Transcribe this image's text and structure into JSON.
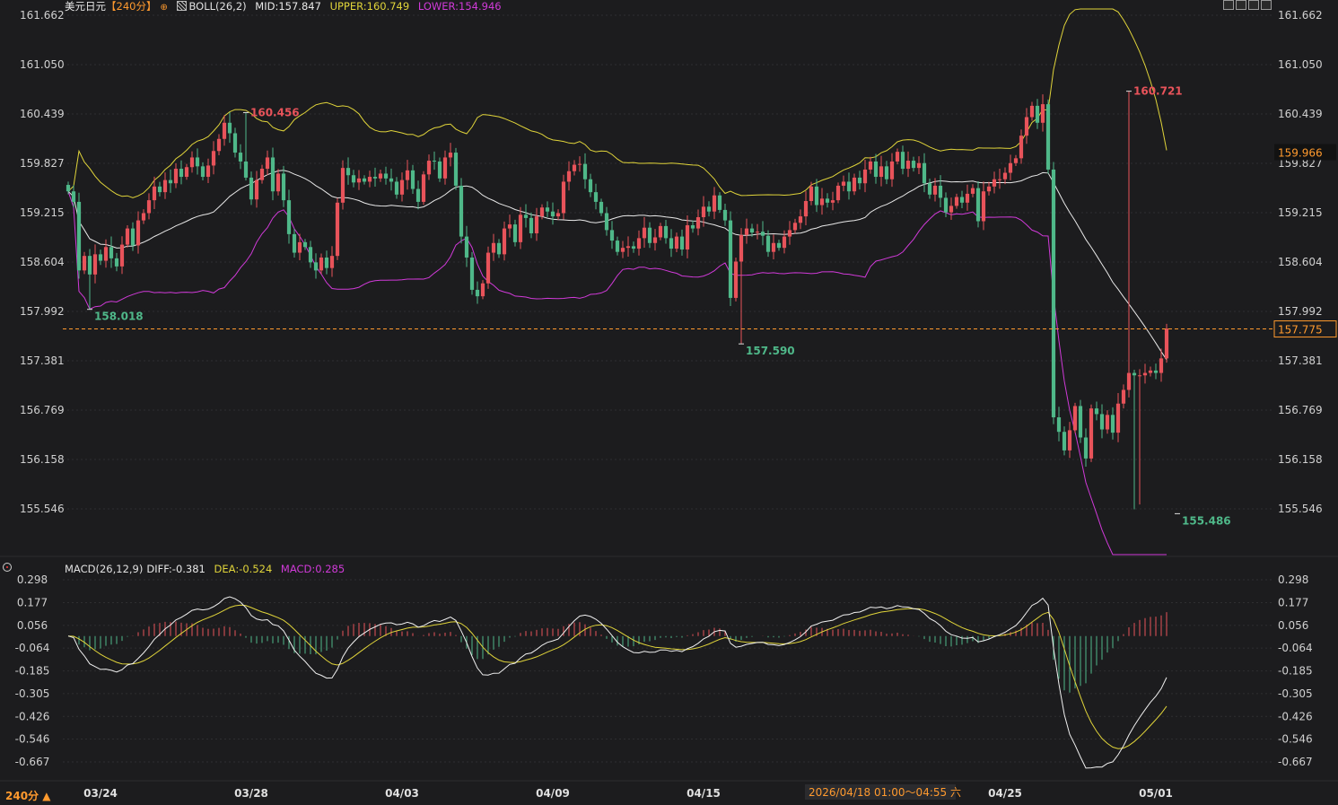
{
  "header": {
    "symbol": "美元日元",
    "period_tag": "【240分】",
    "boll_label": "BOLL(26,2)",
    "mid": "MID:157.847",
    "upper": "UPPER:160.749",
    "lower": "LOWER:154.946"
  },
  "macd_header": {
    "label": "MACD(26,12,9)",
    "diff": "DIFF:-0.381",
    "dea": "DEA:-0.524",
    "macd": "MACD:0.285"
  },
  "period_selector": "240分 ▲",
  "time_tooltip": "2026/04/18 01:00～04:55 六",
  "colors": {
    "up": "#e8535a",
    "down": "#4fb889",
    "boll_mid": "#e8e8e8",
    "boll_upper": "#e0d43a",
    "boll_lower": "#d03ad8",
    "dea": "#e0d43a",
    "diff": "#f0f0f0",
    "macd_label": "#d03ad8",
    "price_line": "#ff9a2e"
  },
  "chart_data": {
    "type": "candlestick",
    "price_axis": {
      "ticks": [
        161.662,
        161.05,
        160.439,
        159.827,
        159.215,
        158.604,
        157.992,
        157.381,
        156.769,
        156.158,
        155.546
      ],
      "range": [
        155.09,
        161.77
      ],
      "current_price": "157.775",
      "hover_price": "159.966"
    },
    "macd_axis": {
      "ticks": [
        0.298,
        0.177,
        0.056,
        -0.064,
        -0.185,
        -0.305,
        -0.426,
        -0.546,
        -0.667
      ],
      "range": [
        -0.8,
        0.34
      ]
    },
    "date_labels": [
      "03/24",
      "03/28",
      "04/03",
      "04/09",
      "04/15",
      "04/25",
      "05/01"
    ],
    "annotations": [
      {
        "text": "160.456",
        "kind": "high"
      },
      {
        "text": "158.018",
        "kind": "low"
      },
      {
        "text": "157.590",
        "kind": "low"
      },
      {
        "text": "160.721",
        "kind": "high"
      },
      {
        "text": "155.486",
        "kind": "low"
      }
    ],
    "candle_closes": [
      159.48,
      159.35,
      158.5,
      158.68,
      158.45,
      158.7,
      158.62,
      158.79,
      158.65,
      158.55,
      158.82,
      159.02,
      158.81,
      159.12,
      159.21,
      159.37,
      159.54,
      159.47,
      159.62,
      159.58,
      159.76,
      159.66,
      159.78,
      159.9,
      159.79,
      159.66,
      159.8,
      159.98,
      160.13,
      160.33,
      160.2,
      159.96,
      159.85,
      159.65,
      159.38,
      159.62,
      159.76,
      159.9,
      159.48,
      159.7,
      159.37,
      158.95,
      158.72,
      158.85,
      158.79,
      158.6,
      158.5,
      158.66,
      158.53,
      158.68,
      159.34,
      159.77,
      159.68,
      159.59,
      159.64,
      159.6,
      159.66,
      159.64,
      159.7,
      159.64,
      159.6,
      159.44,
      159.62,
      159.74,
      159.51,
      159.35,
      159.69,
      159.86,
      159.85,
      159.64,
      159.9,
      159.96,
      159.55,
      158.92,
      158.66,
      158.26,
      158.18,
      158.34,
      158.72,
      158.84,
      158.7,
      159.02,
      159.07,
      158.85,
      159.19,
      159.15,
      158.96,
      159.17,
      159.28,
      159.23,
      159.17,
      159.21,
      159.6,
      159.73,
      159.81,
      159.82,
      159.63,
      159.47,
      159.35,
      159.21,
      159.0,
      158.87,
      158.73,
      158.78,
      158.8,
      158.77,
      158.9,
      159.03,
      158.84,
      158.91,
      159.05,
      158.9,
      158.77,
      158.92,
      158.76,
      159.06,
      159.02,
      159.16,
      159.29,
      159.23,
      159.43,
      159.25,
      159.12,
      158.16,
      158.61,
      158.94,
      159.02,
      158.97,
      158.98,
      158.93,
      158.73,
      158.84,
      158.78,
      158.92,
      159.0,
      159.09,
      159.17,
      159.36,
      159.54,
      159.31,
      159.39,
      159.34,
      159.37,
      159.55,
      159.6,
      159.48,
      159.65,
      159.58,
      159.75,
      159.85,
      159.66,
      159.79,
      159.63,
      159.85,
      159.97,
      159.76,
      159.86,
      159.77,
      159.83,
      159.58,
      159.44,
      159.55,
      159.4,
      159.22,
      159.3,
      159.41,
      159.34,
      159.45,
      159.52,
      159.11,
      159.48,
      159.54,
      159.63,
      159.63,
      159.71,
      159.83,
      159.89,
      160.17,
      160.4,
      160.54,
      160.33,
      160.56,
      159.75,
      156.68,
      156.5,
      156.27,
      156.52,
      156.82,
      156.43,
      156.17,
      156.79,
      156.72,
      156.53,
      156.71,
      156.49,
      156.85,
      157.02,
      157.23,
      157.2,
      157.2,
      157.23,
      157.26,
      157.23,
      157.41,
      157.78
    ],
    "series": [
      {
        "name": "MID",
        "latest": 157.847
      },
      {
        "name": "UPPER",
        "latest": 160.749
      },
      {
        "name": "LOWER",
        "latest": 154.946
      },
      {
        "name": "DIFF",
        "latest": -0.381
      },
      {
        "name": "DEA",
        "latest": -0.524
      },
      {
        "name": "MACD",
        "latest": 0.285
      }
    ]
  }
}
